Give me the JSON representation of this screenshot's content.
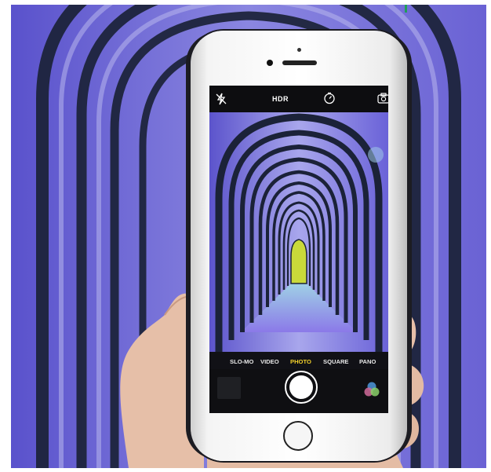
{
  "camera_app": {
    "topbar": {
      "flash_icon": "flash-off-icon",
      "hdr_label": "HDR",
      "timer_icon": "timer-icon",
      "flip_icon": "camera-flip-icon"
    },
    "modes": [
      {
        "label": "SLO-MO",
        "active": false
      },
      {
        "label": "VIDEO",
        "active": false
      },
      {
        "label": "PHOTO",
        "active": true
      },
      {
        "label": "SQUARE",
        "active": false
      },
      {
        "label": "PANO",
        "active": false
      }
    ],
    "controls": {
      "shutter_icon": "shutter-button",
      "filters_icon": "filters-icon"
    }
  },
  "colors": {
    "background_purple": "#6b63d6",
    "arch_dark": "#1b2238",
    "tunnel_end": "#c9d93a",
    "active_mode": "#f2d02a",
    "accent_green": "#1f9e58"
  }
}
